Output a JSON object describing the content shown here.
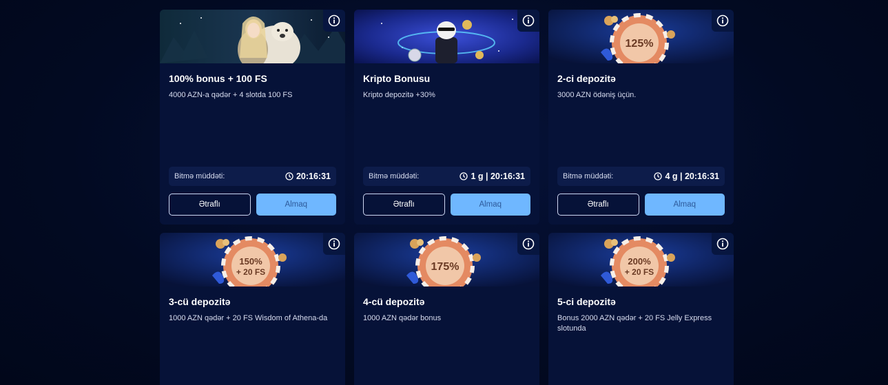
{
  "colors": {
    "page_bg": "#020b26",
    "card_bg": "#061238",
    "expiry_bg": "#0d1c4a",
    "accent": "#6fb7ff"
  },
  "cards": [
    {
      "banner": "woman-and-polar-bear",
      "title": "100% bonus + 100 FS",
      "desc": "4000 AZN-a qədər + 4 slotda 100 FS",
      "expiry_label": "Bitmə müddəti:",
      "expiry_time": "20:16:31",
      "more_label": "Ətraflı",
      "claim_label": "Almaq"
    },
    {
      "banner": "crypto-polar-bear",
      "title": "Kripto Bonusu",
      "desc": "Kripto depozitə +30%",
      "expiry_label": "Bitmə müddəti:",
      "expiry_time": "1 g | 20:16:31",
      "more_label": "Ətraflı",
      "claim_label": "Almaq"
    },
    {
      "banner": "casino-chip",
      "chip_text": [
        "125%"
      ],
      "title": "2-ci depozitə",
      "desc": "3000 AZN ödəniş üçün.",
      "expiry_label": "Bitmə müddəti:",
      "expiry_time": "4 g | 20:16:31",
      "more_label": "Ətraflı",
      "claim_label": "Almaq"
    },
    {
      "banner": "casino-chip",
      "chip_text": [
        "150%",
        "+ 20 FS"
      ],
      "title": "3-cü depozitə",
      "desc": "1000 AZN qədər + 20 FS Wisdom of Athena-da"
    },
    {
      "banner": "casino-chip",
      "chip_text": [
        "175%"
      ],
      "title": "4-cü depozitə",
      "desc": "1000 AZN qədər bonus"
    },
    {
      "banner": "casino-chip",
      "chip_text": [
        "200%",
        "+ 20 FS"
      ],
      "title": "5-ci depozitə",
      "desc": "Bonus 2000 AZN qədər + 20 FS Jelly Express slotunda"
    }
  ]
}
